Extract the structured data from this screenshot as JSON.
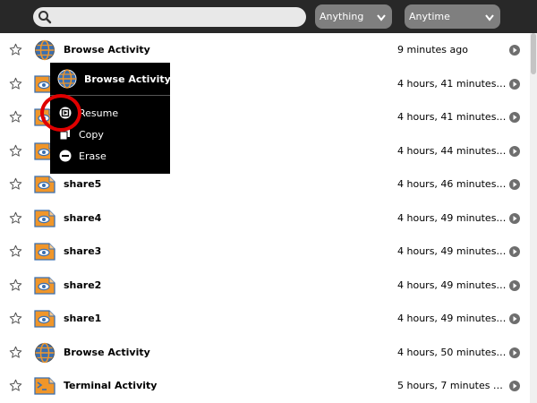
{
  "toolbar": {
    "search_placeholder": "",
    "filter_what": "Anything",
    "filter_when": "Anytime"
  },
  "colors": {
    "toolbar": "#282828",
    "share_icon": "#f0962a",
    "activity_icon": "#3a6fb0",
    "annotation": "#e00000"
  },
  "rows": [
    {
      "title": "Browse Activity",
      "time": "9 minutes ago",
      "icon": "browse-icon"
    },
    {
      "title": "",
      "time": "4 hours, 41 minutes…",
      "icon": "share-icon"
    },
    {
      "title": "",
      "time": "4 hours, 41 minutes…",
      "icon": "share-icon"
    },
    {
      "title": "",
      "time": "4 hours, 44 minutes…",
      "icon": "share-icon"
    },
    {
      "title": "share5",
      "time": "4 hours, 46 minutes…",
      "icon": "share-icon"
    },
    {
      "title": "share4",
      "time": "4 hours, 49 minutes…",
      "icon": "share-icon"
    },
    {
      "title": "share3",
      "time": "4 hours, 49 minutes…",
      "icon": "share-icon"
    },
    {
      "title": "share2",
      "time": "4 hours, 49 minutes…",
      "icon": "share-icon"
    },
    {
      "title": "share1",
      "time": "4 hours, 49 minutes…",
      "icon": "share-icon"
    },
    {
      "title": "Browse Activity",
      "time": "4 hours, 50 minutes…",
      "icon": "browse-icon"
    },
    {
      "title": "Terminal Activity",
      "time": "5 hours, 7 minutes …",
      "icon": "terminal-icon"
    }
  ],
  "palette": {
    "title": "Browse Activity",
    "items": [
      {
        "label": "Resume",
        "icon": "resume-icon"
      },
      {
        "label": "Copy",
        "icon": "copy-icon"
      },
      {
        "label": "Erase",
        "icon": "erase-icon"
      }
    ]
  }
}
